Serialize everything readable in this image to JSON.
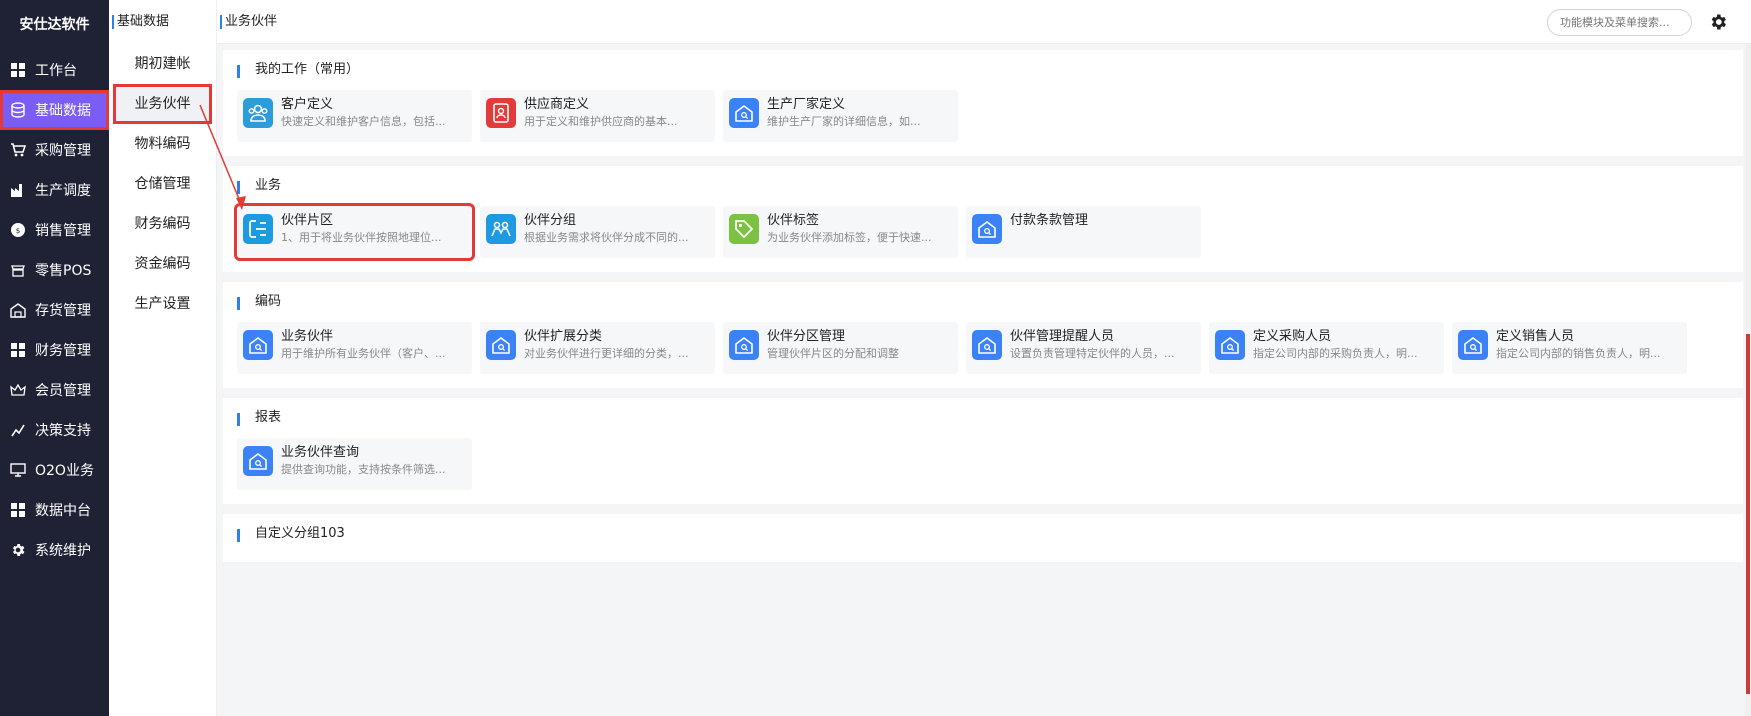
{
  "app": {
    "brand": "安仕达软件"
  },
  "sidebar": {
    "items": [
      {
        "label": "工作台",
        "icon": "grid-icon"
      },
      {
        "label": "基础数据",
        "icon": "database-icon",
        "active": true
      },
      {
        "label": "采购管理",
        "icon": "cart-icon"
      },
      {
        "label": "生产调度",
        "icon": "factory-icon"
      },
      {
        "label": "销售管理",
        "icon": "sales-icon"
      },
      {
        "label": "零售POS",
        "icon": "pos-icon"
      },
      {
        "label": "存货管理",
        "icon": "warehouse-icon"
      },
      {
        "label": "财务管理",
        "icon": "grid-icon"
      },
      {
        "label": "会员管理",
        "icon": "crown-icon"
      },
      {
        "label": "决策支持",
        "icon": "decision-icon"
      },
      {
        "label": "O2O业务",
        "icon": "monitor-icon"
      },
      {
        "label": "数据中台",
        "icon": "grid-icon"
      },
      {
        "label": "系统维护",
        "icon": "gear-icon"
      }
    ]
  },
  "subnav": {
    "header": "基础数据",
    "items": [
      "期初建帐",
      "业务伙伴",
      "物料编码",
      "仓储管理",
      "财务编码",
      "资金编码",
      "生产设置"
    ],
    "active_index": 1
  },
  "topbar": {
    "breadcrumb": "业务伙伴",
    "search_placeholder": "功能模块及菜单搜索..."
  },
  "sections": [
    {
      "title": "我的工作（常用）",
      "cards": [
        {
          "title": "客户定义",
          "desc": "快速定义和维护客户信息，包括...",
          "icon": "customers-icon",
          "color": "#2d9cdb"
        },
        {
          "title": "供应商定义",
          "desc": "用于定义和维护供应商的基本...",
          "icon": "supplier-badge-icon",
          "color": "#e23b3b"
        },
        {
          "title": "生产厂家定义",
          "desc": "维护生产厂家的详细信息，如...",
          "icon": "house-icon",
          "color": "#3b82f6"
        }
      ]
    },
    {
      "title": "业务",
      "cards": [
        {
          "title": "伙伴片区",
          "desc": "1、用于将业务伙伴按照地理位...",
          "icon": "region-icon",
          "color": "#1e9be0",
          "highlight": true
        },
        {
          "title": "伙伴分组",
          "desc": "根据业务需求将伙伴分成不同的...",
          "icon": "group-icon",
          "color": "#1e9be0"
        },
        {
          "title": "伙伴标签",
          "desc": "为业务伙伴添加标签，便于快速...",
          "icon": "tag-icon",
          "color": "#7cc242"
        },
        {
          "title": "付款条款管理",
          "desc": "",
          "icon": "house-icon",
          "color": "#3b82f6"
        }
      ]
    },
    {
      "title": "编码",
      "cards": [
        {
          "title": "业务伙伴",
          "desc": "用于维护所有业务伙伴（客户、...",
          "icon": "house-icon",
          "color": "#3b82f6"
        },
        {
          "title": "伙伴扩展分类",
          "desc": "对业务伙伴进行更详细的分类，...",
          "icon": "house-icon",
          "color": "#3b82f6"
        },
        {
          "title": "伙伴分区管理",
          "desc": "管理伙伴片区的分配和调整",
          "icon": "house-icon",
          "color": "#3b82f6"
        },
        {
          "title": "伙伴管理提醒人员",
          "desc": "设置负责管理特定伙伴的人员，...",
          "icon": "house-icon",
          "color": "#3b82f6"
        },
        {
          "title": "定义采购人员",
          "desc": "指定公司内部的采购负责人，明...",
          "icon": "house-icon",
          "color": "#3b82f6"
        },
        {
          "title": "定义销售人员",
          "desc": "指定公司内部的销售负责人，明...",
          "icon": "house-icon",
          "color": "#3b82f6"
        }
      ]
    },
    {
      "title": "报表",
      "cards": [
        {
          "title": "业务伙伴查询",
          "desc": "提供查询功能，支持按条件筛选...",
          "icon": "house-icon",
          "color": "#3b82f6"
        }
      ]
    },
    {
      "title": "自定义分组103",
      "cards": []
    }
  ]
}
